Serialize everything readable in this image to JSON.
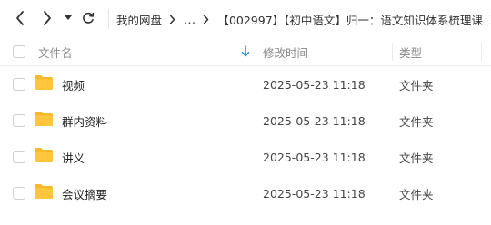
{
  "toolbar": {
    "back_icon": "chevron-left-icon",
    "forward_icon": "chevron-right-icon",
    "history_dropdown_icon": "caret-down-icon",
    "refresh_icon": "refresh-icon"
  },
  "breadcrumb": {
    "items": [
      "我的网盘",
      "...",
      "【002997】【初中语文】归一：语文知识体系梳理课"
    ]
  },
  "header": {
    "name_label": "文件名",
    "mtime_label": "修改时间",
    "type_label": "类型",
    "sort_icon": "sort-down-arrow-icon"
  },
  "files": [
    {
      "name": "视频",
      "modified": "2025-05-23 11:18",
      "type": "文件夹"
    },
    {
      "name": "群内资料",
      "modified": "2025-05-23 11:18",
      "type": "文件夹"
    },
    {
      "name": "讲义",
      "modified": "2025-05-23 11:18",
      "type": "文件夹"
    },
    {
      "name": "会议摘要",
      "modified": "2025-05-23 11:18",
      "type": "文件夹"
    }
  ],
  "colors": {
    "folder": "#FFC53D",
    "folder_back": "#F7B928",
    "accent": "#1E88E5"
  }
}
